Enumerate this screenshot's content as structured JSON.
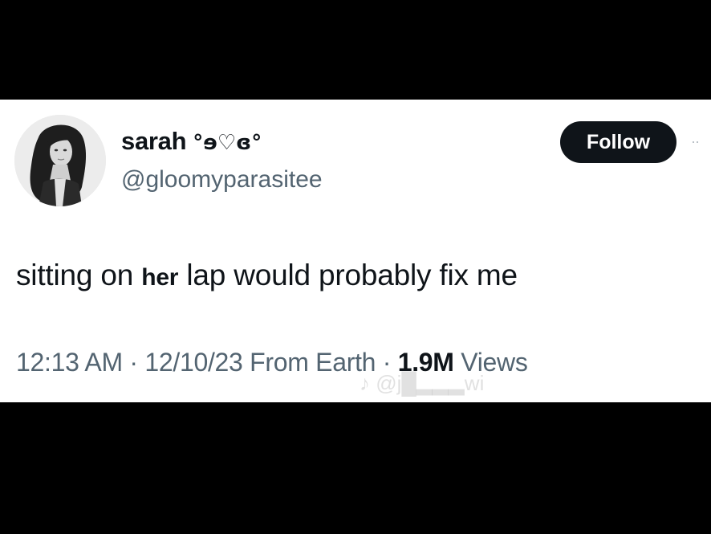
{
  "tweet": {
    "author": {
      "display_name": "sarah",
      "name_decoration": "°ɘ♡ɞ°",
      "handle": "@gloomyparasitee",
      "avatar_icon": "profile-photo"
    },
    "follow_label": "Follow",
    "more_icon": "more-dots-icon",
    "text_before": "sitting on",
    "text_emphasis": "her",
    "text_after": "lap would probably fix me",
    "time": "12:13 AM",
    "separator": "·",
    "date": "12/10/23",
    "location": "From Earth",
    "views_count": "1.9M",
    "views_label": "Views"
  },
  "watermark": {
    "text": "♪ @j█▂▂▂wi"
  },
  "colors": {
    "background": "#000000",
    "card": "#ffffff",
    "primary_text": "#0f1419",
    "secondary_text": "#536471",
    "button_bg": "#0f1419"
  }
}
